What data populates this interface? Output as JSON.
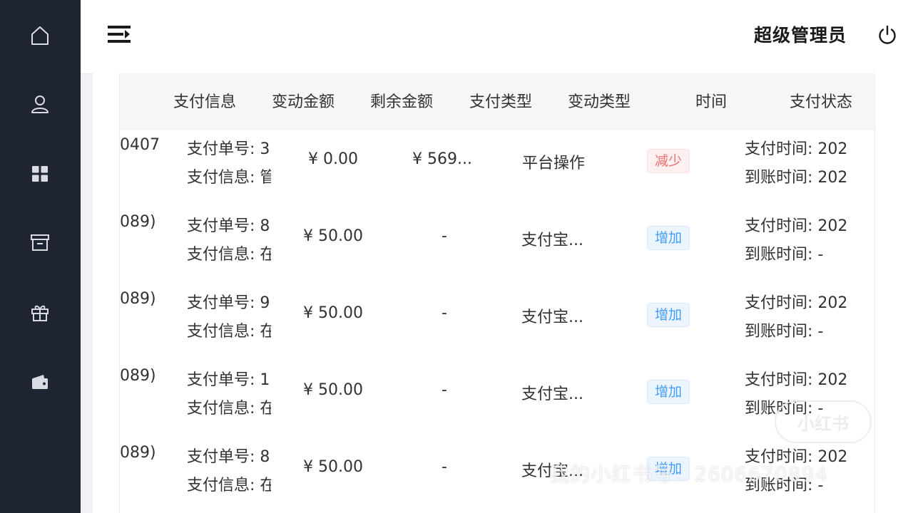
{
  "header": {
    "user_name": "超级管理员"
  },
  "sidebar": {
    "items": [
      {
        "icon": "home-icon"
      },
      {
        "icon": "user-icon"
      },
      {
        "icon": "grid-icon"
      },
      {
        "icon": "archive-icon"
      },
      {
        "icon": "gift-icon"
      },
      {
        "icon": "wallet-icon"
      }
    ]
  },
  "table": {
    "headers": [
      "支付信息",
      "变动金额",
      "剩余金额",
      "支付类型",
      "变动类型",
      "时间",
      "支付状态"
    ],
    "rows": [
      {
        "left_fragment": "0407",
        "order_no": "支付单号: 3",
        "pay_info": "支付信息: 管",
        "change_amount": "¥ 0.00",
        "remaining_amount": "¥ 569...",
        "pay_type": "平台操作",
        "change_type": "减少",
        "pay_time": "支付时间: 202",
        "arrive_time": "到账时间: 202"
      },
      {
        "left_fragment": "089)",
        "order_no": "支付单号: 8",
        "pay_info": "支付信息: 在",
        "change_amount": "¥ 50.00",
        "remaining_amount": "-",
        "pay_type": "支付宝...",
        "change_type": "增加",
        "pay_time": "支付时间: 202",
        "arrive_time": "到账时间: -"
      },
      {
        "left_fragment": "089)",
        "order_no": "支付单号: 9",
        "pay_info": "支付信息: 在",
        "change_amount": "¥ 50.00",
        "remaining_amount": "-",
        "pay_type": "支付宝...",
        "change_type": "增加",
        "pay_time": "支付时间: 202",
        "arrive_time": "到账时间: -"
      },
      {
        "left_fragment": "089)",
        "order_no": "支付单号: 1",
        "pay_info": "支付信息: 在",
        "change_amount": "¥ 50.00",
        "remaining_amount": "-",
        "pay_type": "支付宝...",
        "change_type": "增加",
        "pay_time": "支付时间: 202",
        "arrive_time": "到账时间: -"
      },
      {
        "left_fragment": "089)",
        "order_no": "支付单号: 8",
        "pay_info": "支付信息: 在",
        "change_amount": "¥ 50.00",
        "remaining_amount": "-",
        "pay_type": "支付宝...",
        "change_type": "增加",
        "pay_time": "支付时间: 202",
        "arrive_time": "到账时间: -"
      }
    ]
  },
  "watermark": {
    "text": "我的小红书号：2606670894",
    "logo": "小红书"
  },
  "colors": {
    "sidebar_bg": "#1f2433",
    "badge_decrease": "#f56c6c",
    "badge_increase": "#409eff"
  }
}
